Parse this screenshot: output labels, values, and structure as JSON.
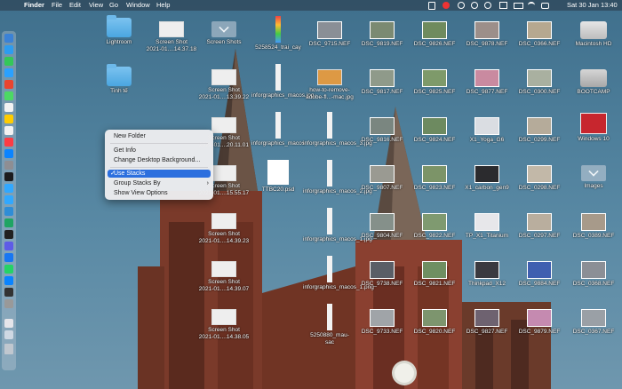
{
  "menubar": {
    "apple": "",
    "app": "Finder",
    "menus": [
      "File",
      "Edit",
      "View",
      "Go",
      "Window",
      "Help"
    ],
    "clock": "Sat 30 Jan  13:40"
  },
  "context_menu": {
    "items": [
      {
        "label": "New Folder"
      },
      {
        "label": "Get Info"
      },
      {
        "label": "Change Desktop Background..."
      },
      {
        "label": "Use Stacks",
        "checked": true
      },
      {
        "label": "Group Stacks By",
        "submenu": true
      },
      {
        "label": "Show View Options"
      }
    ]
  },
  "desktop": {
    "icons": [
      {
        "label": "Lightroom",
        "kind": "folder"
      },
      {
        "label": "Tinh tế",
        "kind": "folder"
      },
      {
        "label": "Screen Shot\n2021-01....14.37.18",
        "kind": "screenshot"
      },
      {
        "label": "Screen Shots",
        "kind": "stack"
      },
      {
        "label": "5258524_trai_cay",
        "kind": "tall"
      },
      {
        "label": "DSC_9715.NEF",
        "kind": "photo"
      },
      {
        "label": "DSC_9819.NEF",
        "kind": "photo"
      },
      {
        "label": "DSC_9826.NEF",
        "kind": "photo"
      },
      {
        "label": "DSC_9878.NEF",
        "kind": "photo"
      },
      {
        "label": "DSC_0366.NEF",
        "kind": "photo"
      },
      {
        "label": "Macintosh HD",
        "kind": "drive"
      },
      {
        "label": "Screen Shot\n2021-01....13.39.22",
        "kind": "screenshot"
      },
      {
        "label": "inforgraphics_macos.jpg",
        "kind": "tall"
      },
      {
        "label": "how-to-remove-\nadobe-fl...-mac.jpg",
        "kind": "screenshot"
      },
      {
        "label": "DSC_9817.NEF",
        "kind": "photo"
      },
      {
        "label": "DSC_9825.NEF",
        "kind": "photo"
      },
      {
        "label": "DSC_9877.NEF",
        "kind": "photo"
      },
      {
        "label": "DSC_0300.NEF",
        "kind": "photo"
      },
      {
        "label": "BOOTCAMP",
        "kind": "bootcamp"
      },
      {
        "label": "Screen Shot\n2021-01....20.11.01",
        "kind": "screenshot"
      },
      {
        "label": "inforgraphics_macos",
        "kind": "tall"
      },
      {
        "label": "inforgraphics_macos_3.jpg",
        "kind": "tall"
      },
      {
        "label": "DSC_9816.NEF",
        "kind": "photo"
      },
      {
        "label": "DSC_9824.NEF",
        "kind": "photo"
      },
      {
        "label": "X1_Yoga_G6",
        "kind": "photo"
      },
      {
        "label": "DSC_0299.NEF",
        "kind": "photo"
      },
      {
        "label": "Windows 10",
        "kind": "parallels"
      },
      {
        "label": "Screen Shot\n2021-01....15.55.17",
        "kind": "screenshot"
      },
      {
        "label": "TTBC20.psd",
        "kind": "doc"
      },
      {
        "label": "inforgraphics_macos_2.jpg",
        "kind": "tall"
      },
      {
        "label": "DSC_9807.NEF",
        "kind": "photo"
      },
      {
        "label": "DSC_9823.NEF",
        "kind": "photo"
      },
      {
        "label": "X1_carbon_gen9",
        "kind": "photo"
      },
      {
        "label": "DSC_0298.NEF",
        "kind": "photo"
      },
      {
        "label": "Images",
        "kind": "stack"
      },
      {
        "label": "Screen Shot\n2021-01....14.39.23",
        "kind": "screenshot"
      },
      {
        "label": "inforgraphics_macos_1.jpg",
        "kind": "tall"
      },
      {
        "label": "DSC_9804.NEF",
        "kind": "photo"
      },
      {
        "label": "DSC_9822.NEF",
        "kind": "photo"
      },
      {
        "label": "TP_X1_Titanium",
        "kind": "photo"
      },
      {
        "label": "DSC_0297.NEF",
        "kind": "photo"
      },
      {
        "label": "DSC_0389.NEF",
        "kind": "photo"
      },
      {
        "label": "Screen Shot\n2021-01....14.39.07",
        "kind": "screenshot"
      },
      {
        "label": "inforgraphics_macos_1.png",
        "kind": "tall"
      },
      {
        "label": "DSC_9738.NEF",
        "kind": "photo"
      },
      {
        "label": "DSC_9821.NEF",
        "kind": "photo"
      },
      {
        "label": "Thinkpad_X12",
        "kind": "photo"
      },
      {
        "label": "DSC_9884.NEF",
        "kind": "photo"
      },
      {
        "label": "DSC_0368.NEF",
        "kind": "photo"
      },
      {
        "label": "Screen Shot\n2021-01....14.38.05",
        "kind": "screenshot"
      },
      {
        "label": "5250880_mau-\nsac",
        "kind": "tall"
      },
      {
        "label": "DSC_9733.NEF",
        "kind": "photo"
      },
      {
        "label": "DSC_9820.NEF",
        "kind": "photo"
      },
      {
        "label": "DSC_9827.NEF",
        "kind": "photo"
      },
      {
        "label": "DSC_9879.NEF",
        "kind": "photo"
      },
      {
        "label": "DSC_0367.NEF",
        "kind": "photo"
      }
    ]
  }
}
